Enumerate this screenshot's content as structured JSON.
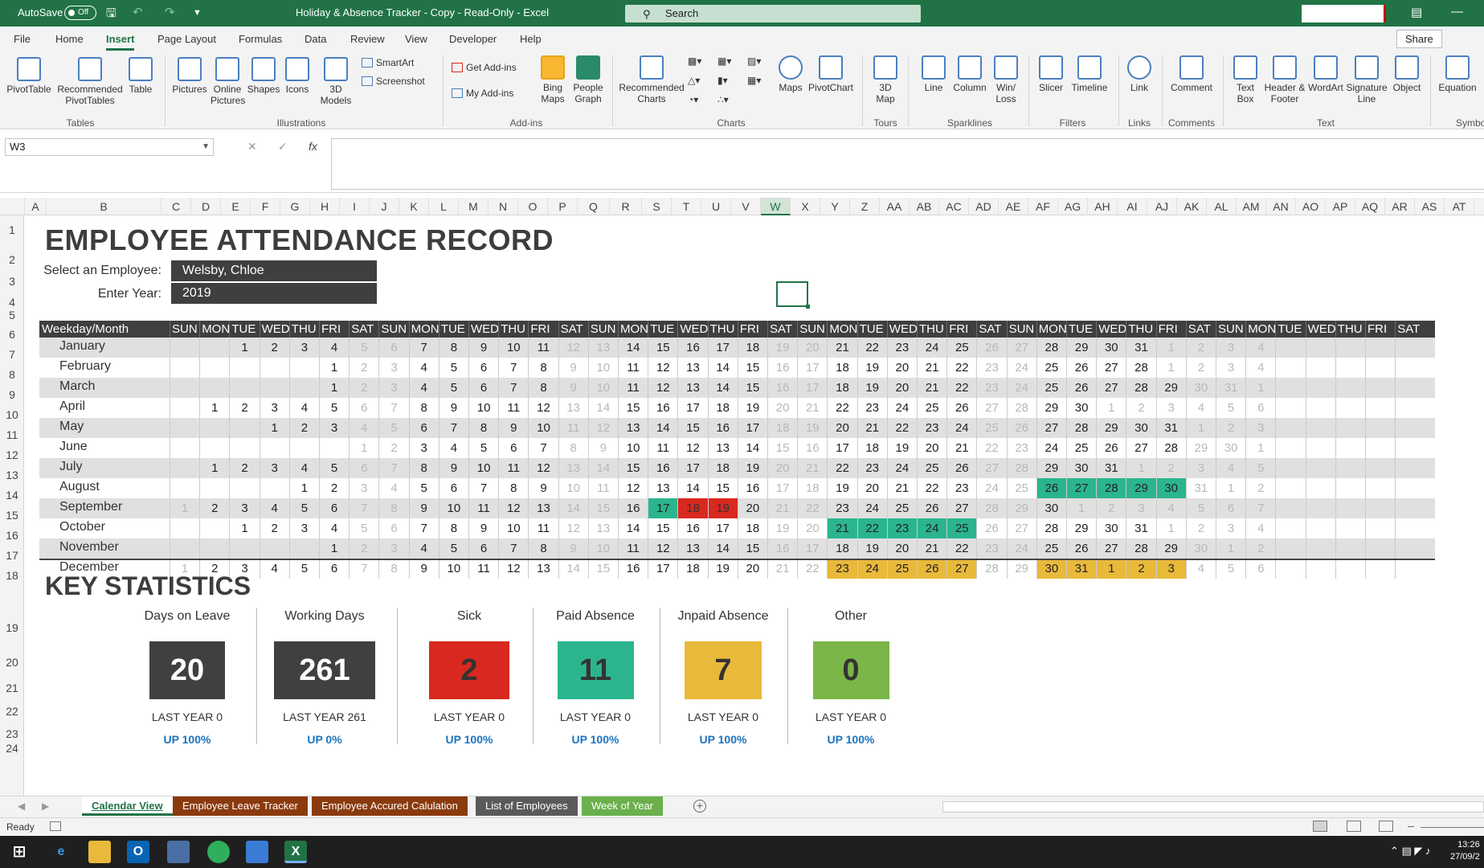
{
  "titlebar": {
    "autosave_label": "AutoSave",
    "autosave_state": "Off",
    "doc_title": "Holiday & Absence Tracker - Copy  -  Read-Only  -  Excel",
    "search_placeholder": "Search"
  },
  "ribbon": {
    "tabs": [
      "File",
      "Home",
      "Insert",
      "Page Layout",
      "Formulas",
      "Data",
      "Review",
      "View",
      "Developer",
      "Help"
    ],
    "active_tab": "Insert",
    "share_label": "Share",
    "buttons": {
      "pivot_table": "PivotTable",
      "recommended_pivot": "Recommended PivotTables",
      "table": "Table",
      "pictures": "Pictures",
      "online_pictures": "Online Pictures",
      "shapes": "Shapes",
      "icons": "Icons",
      "models3d": "3D Models",
      "smartart": "SmartArt",
      "screenshot": "Screenshot",
      "get_addins": "Get Add-ins",
      "my_addins": "My Add-ins",
      "bing_maps": "Bing Maps",
      "people_graph": "People Graph",
      "recommended_charts": "Recommended Charts",
      "maps": "Maps",
      "pivotchart": "PivotChart",
      "map3d": "3D Map",
      "line": "Line",
      "column": "Column",
      "winloss": "Win/ Loss",
      "slicer": "Slicer",
      "timeline": "Timeline",
      "link": "Link",
      "comment": "Comment",
      "textbox": "Text Box",
      "header_footer": "Header & Footer",
      "wordart": "WordArt",
      "signature": "Signature Line",
      "object": "Object",
      "equation": "Equation"
    },
    "groups": [
      "Tables",
      "Illustrations",
      "Add-ins",
      "Charts",
      "Tours",
      "Sparklines",
      "Filters",
      "Links",
      "Comments",
      "Text",
      "Symbo"
    ]
  },
  "formula_bar": {
    "name_box": "W3",
    "fx": "fx"
  },
  "columns": [
    "A",
    "B",
    "C",
    "D",
    "E",
    "F",
    "G",
    "H",
    "I",
    "J",
    "K",
    "L",
    "M",
    "N",
    "O",
    "P",
    "Q",
    "R",
    "S",
    "T",
    "U",
    "V",
    "W",
    "X",
    "Y",
    "Z",
    "AA",
    "AB",
    "AC",
    "AD",
    "AE",
    "AF",
    "AG",
    "AH",
    "AI",
    "AJ",
    "AK",
    "AL",
    "AM",
    "AN",
    "AO",
    "AP",
    "AQ",
    "AR",
    "AS",
    "AT"
  ],
  "selected_column": "W",
  "rows": [
    "1",
    "2",
    "3",
    "4",
    "5",
    "6",
    "7",
    "8",
    "9",
    "10",
    "11",
    "12",
    "13",
    "14",
    "15",
    "16",
    "17",
    "18",
    "19",
    "20",
    "21",
    "22",
    "23",
    "24"
  ],
  "sheet": {
    "title": "EMPLOYEE ATTENDANCE RECORD",
    "employee_label": "Select an Employee:",
    "employee_value": "Welsby, Chloe",
    "year_label": "Enter Year:",
    "year_value": "2019",
    "calendar_corner": "Weekday/Month",
    "weekdays": [
      "SUN",
      "MON",
      "TUE",
      "WED",
      "THU",
      "FRI",
      "SAT",
      "SUN",
      "MON",
      "TUE",
      "WED",
      "THU",
      "FRI",
      "SAT",
      "SUN",
      "MON",
      "TUE",
      "WED",
      "THU",
      "FRI",
      "SAT",
      "SUN",
      "MON",
      "TUE",
      "WED",
      "THU",
      "FRI",
      "SAT",
      "SUN",
      "MON",
      "TUE",
      "WED",
      "THU",
      "FRI",
      "SAT",
      "SUN",
      "MON",
      "TUE",
      "WED",
      "THU",
      "FRI",
      "SAT"
    ],
    "months": [
      {
        "name": "January",
        "start": 2,
        "days": 31
      },
      {
        "name": "February",
        "start": 5,
        "days": 28
      },
      {
        "name": "March",
        "start": 5,
        "days": 31
      },
      {
        "name": "April",
        "start": 1,
        "days": 30
      },
      {
        "name": "May",
        "start": 3,
        "days": 31
      },
      {
        "name": "June",
        "start": 6,
        "days": 30
      },
      {
        "name": "July",
        "start": 1,
        "days": 31
      },
      {
        "name": "August",
        "start": 4,
        "days": 31
      },
      {
        "name": "September",
        "start": 0,
        "days": 30
      },
      {
        "name": "October",
        "start": 2,
        "days": 31
      },
      {
        "name": "November",
        "start": 5,
        "days": 30
      },
      {
        "name": "December",
        "start": 0,
        "days": 31
      }
    ],
    "highlights": [
      {
        "month": "August",
        "days": [
          26,
          27,
          28,
          29,
          30
        ],
        "type": "paid"
      },
      {
        "month": "September",
        "days": [
          17
        ],
        "type": "paid"
      },
      {
        "month": "September",
        "days": [
          18,
          19
        ],
        "type": "sick"
      },
      {
        "month": "October",
        "days": [
          21,
          22,
          23,
          24,
          25
        ],
        "type": "paid"
      },
      {
        "month": "December",
        "days": [
          23,
          24,
          25,
          26,
          27,
          30,
          31
        ],
        "type": "unpaid"
      },
      {
        "month": "January",
        "days": [
          1,
          2,
          3
        ],
        "type": "unpaid",
        "overflow_of": "December"
      }
    ],
    "key_stats_title": "KEY STATISTICS",
    "stats": [
      {
        "label": "Days on Leave",
        "value": "20",
        "last_year": "LAST YEAR  0",
        "change": "UP 100%",
        "color": "#404040"
      },
      {
        "label": "Working Days",
        "value": "261",
        "last_year": "LAST YEAR  261",
        "change": "UP 0%",
        "color": "#404040"
      },
      {
        "label": "Sick",
        "value": "2",
        "last_year": "LAST YEAR  0",
        "change": "UP 100%",
        "color": "#d9281f"
      },
      {
        "label": "Paid Absence",
        "value": "11",
        "last_year": "LAST YEAR  0",
        "change": "UP 100%",
        "color": "#2bb58e"
      },
      {
        "label": "Jnpaid Absence",
        "value": "7",
        "last_year": "LAST YEAR  0",
        "change": "UP 100%",
        "color": "#e9b93a"
      },
      {
        "label": "Other",
        "value": "0",
        "last_year": "LAST YEAR  0",
        "change": "UP 100%",
        "color": "#7ab648"
      }
    ]
  },
  "sheet_tabs": [
    {
      "label": "Calendar View",
      "color": "#ffffff",
      "active": true
    },
    {
      "label": "Employee Leave Tracker",
      "color": "#8b3a0e",
      "active": false
    },
    {
      "label": "Employee Accured Calulation",
      "color": "#8b3a0e",
      "active": false
    },
    {
      "label": "List of Employees",
      "color": "#5a5a5a",
      "active": false
    },
    {
      "label": "Week of Year",
      "color": "#6ab04c",
      "active": false
    }
  ],
  "status": {
    "ready": "Ready"
  },
  "taskbar": {
    "time": "13:26",
    "date": "27/09/2"
  }
}
